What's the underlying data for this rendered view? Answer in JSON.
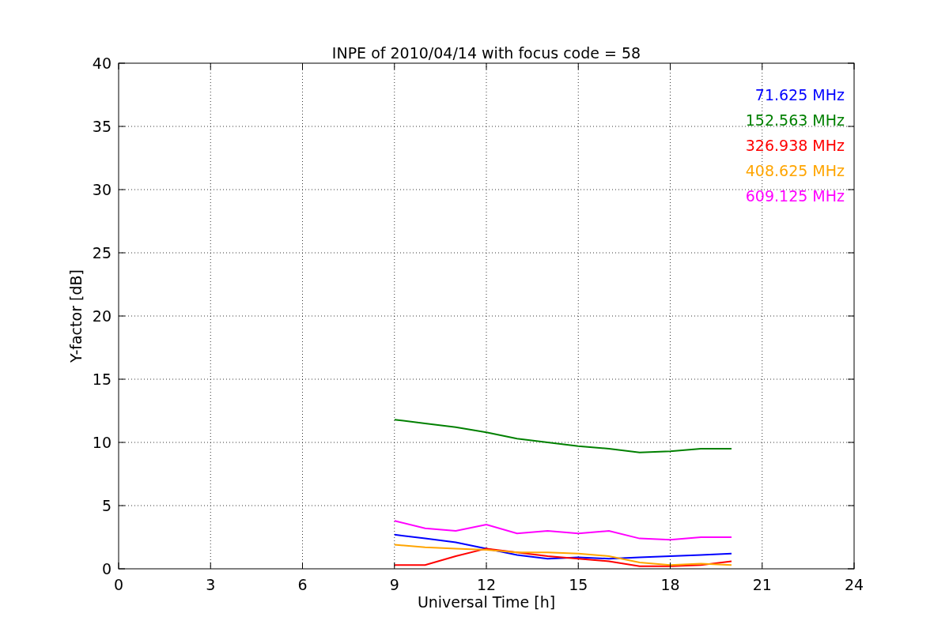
{
  "figure": {
    "chart_data": {
      "type": "line",
      "title": "INPE of 2010/04/14 with focus code = 58",
      "xlabel": "Universal Time [h]",
      "ylabel": "Y-factor [dB]",
      "x": [
        9,
        10,
        11,
        12,
        13,
        14,
        15,
        16,
        17,
        18,
        19,
        20
      ],
      "series": [
        {
          "name": "71.625 MHz",
          "color": "#0000ff",
          "values": [
            2.7,
            2.4,
            2.1,
            1.6,
            1.1,
            0.8,
            0.9,
            0.8,
            0.9,
            1.0,
            1.1,
            1.2
          ]
        },
        {
          "name": "152.563 MHz",
          "color": "#008000",
          "values": [
            11.8,
            11.5,
            11.2,
            10.8,
            10.3,
            10.0,
            9.7,
            9.5,
            9.2,
            9.3,
            9.5,
            9.5
          ]
        },
        {
          "name": "326.938 MHz",
          "color": "#ff0000",
          "values": [
            0.3,
            0.3,
            1.0,
            1.6,
            1.3,
            1.0,
            0.8,
            0.6,
            0.2,
            0.2,
            0.3,
            0.6
          ]
        },
        {
          "name": "408.625 MHz",
          "color": "#ffa500",
          "values": [
            1.9,
            1.7,
            1.6,
            1.5,
            1.3,
            1.3,
            1.2,
            1.0,
            0.5,
            0.3,
            0.4,
            0.3
          ]
        },
        {
          "name": "609.125 MHz",
          "color": "#ff00ff",
          "values": [
            3.8,
            3.2,
            3.0,
            3.5,
            2.8,
            3.0,
            2.8,
            3.0,
            2.4,
            2.3,
            2.5,
            2.5
          ]
        }
      ],
      "xlim": [
        0,
        24
      ],
      "ylim": [
        0,
        40
      ],
      "xticks": [
        0,
        3,
        6,
        9,
        12,
        15,
        18,
        21,
        24
      ],
      "yticks": [
        0,
        5,
        10,
        15,
        20,
        25,
        30,
        35,
        40
      ],
      "grid": true
    }
  }
}
